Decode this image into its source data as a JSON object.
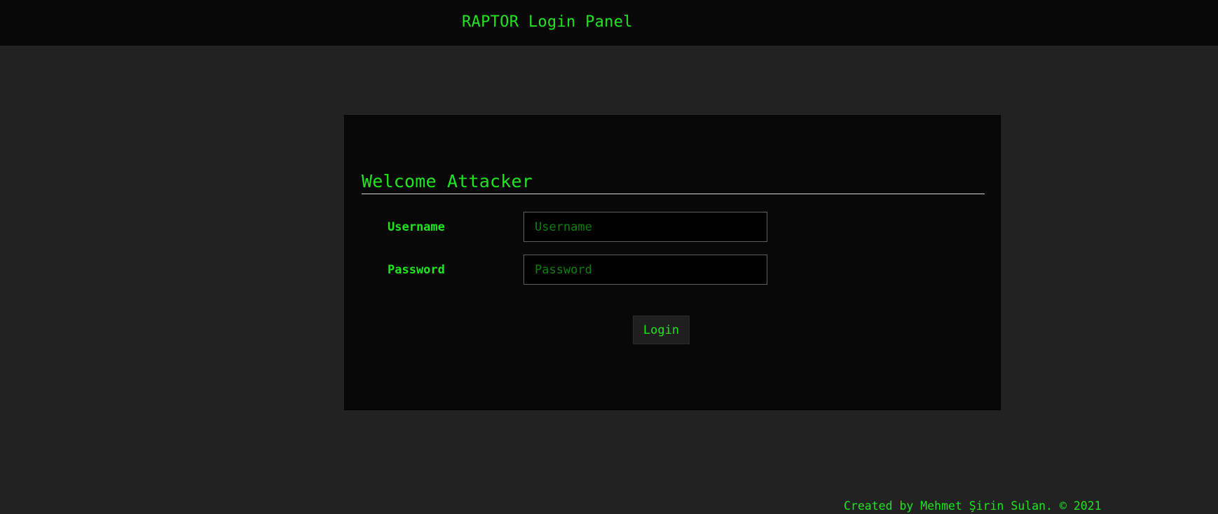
{
  "header": {
    "title": "RAPTOR Login Panel"
  },
  "login_panel": {
    "heading": "Welcome Attacker",
    "username": {
      "label": "Username",
      "placeholder": "Username",
      "value": ""
    },
    "password": {
      "label": "Password",
      "placeholder": "Password",
      "value": ""
    },
    "login_button_label": "Login"
  },
  "footer": {
    "credit": "Created by Mehmet Şirin Sulan. © 2021"
  },
  "colors": {
    "page_background": "#222222",
    "bar_and_panel_background": "#080808",
    "accent_green": "#1fe51f",
    "placeholder_green": "#0d7f0d"
  }
}
